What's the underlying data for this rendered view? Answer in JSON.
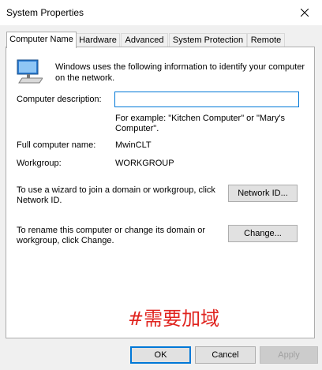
{
  "window": {
    "title": "System Properties"
  },
  "tabs": [
    {
      "label": "Computer Name",
      "active": true
    },
    {
      "label": "Hardware",
      "active": false
    },
    {
      "label": "Advanced",
      "active": false
    },
    {
      "label": "System Protection",
      "active": false
    },
    {
      "label": "Remote",
      "active": false
    }
  ],
  "computer_name_tab": {
    "intro": "Windows uses the following information to identify your computer on the network.",
    "description_label": "Computer description:",
    "description_value": "",
    "example_text": "For example: \"Kitchen Computer\" or \"Mary's Computer\".",
    "full_name_label": "Full computer name:",
    "full_name_value": "MwinCLT",
    "workgroup_label": "Workgroup:",
    "workgroup_value": "WORKGROUP",
    "domain_wizard_text": "To use a wizard to join a domain or workgroup, click Network ID.",
    "network_id_button": "Network ID...",
    "rename_text": "To rename this computer or change its domain or workgroup, click Change.",
    "change_button": "Change..."
  },
  "annotation": "#需要加域",
  "footer": {
    "ok_button": "OK",
    "cancel_button": "Cancel",
    "apply_button": "Apply"
  },
  "icons": {
    "window_close": "close-icon",
    "computer": "computer-icon"
  },
  "colors": {
    "accent": "#0078d7",
    "annotation": "#e0241f"
  }
}
